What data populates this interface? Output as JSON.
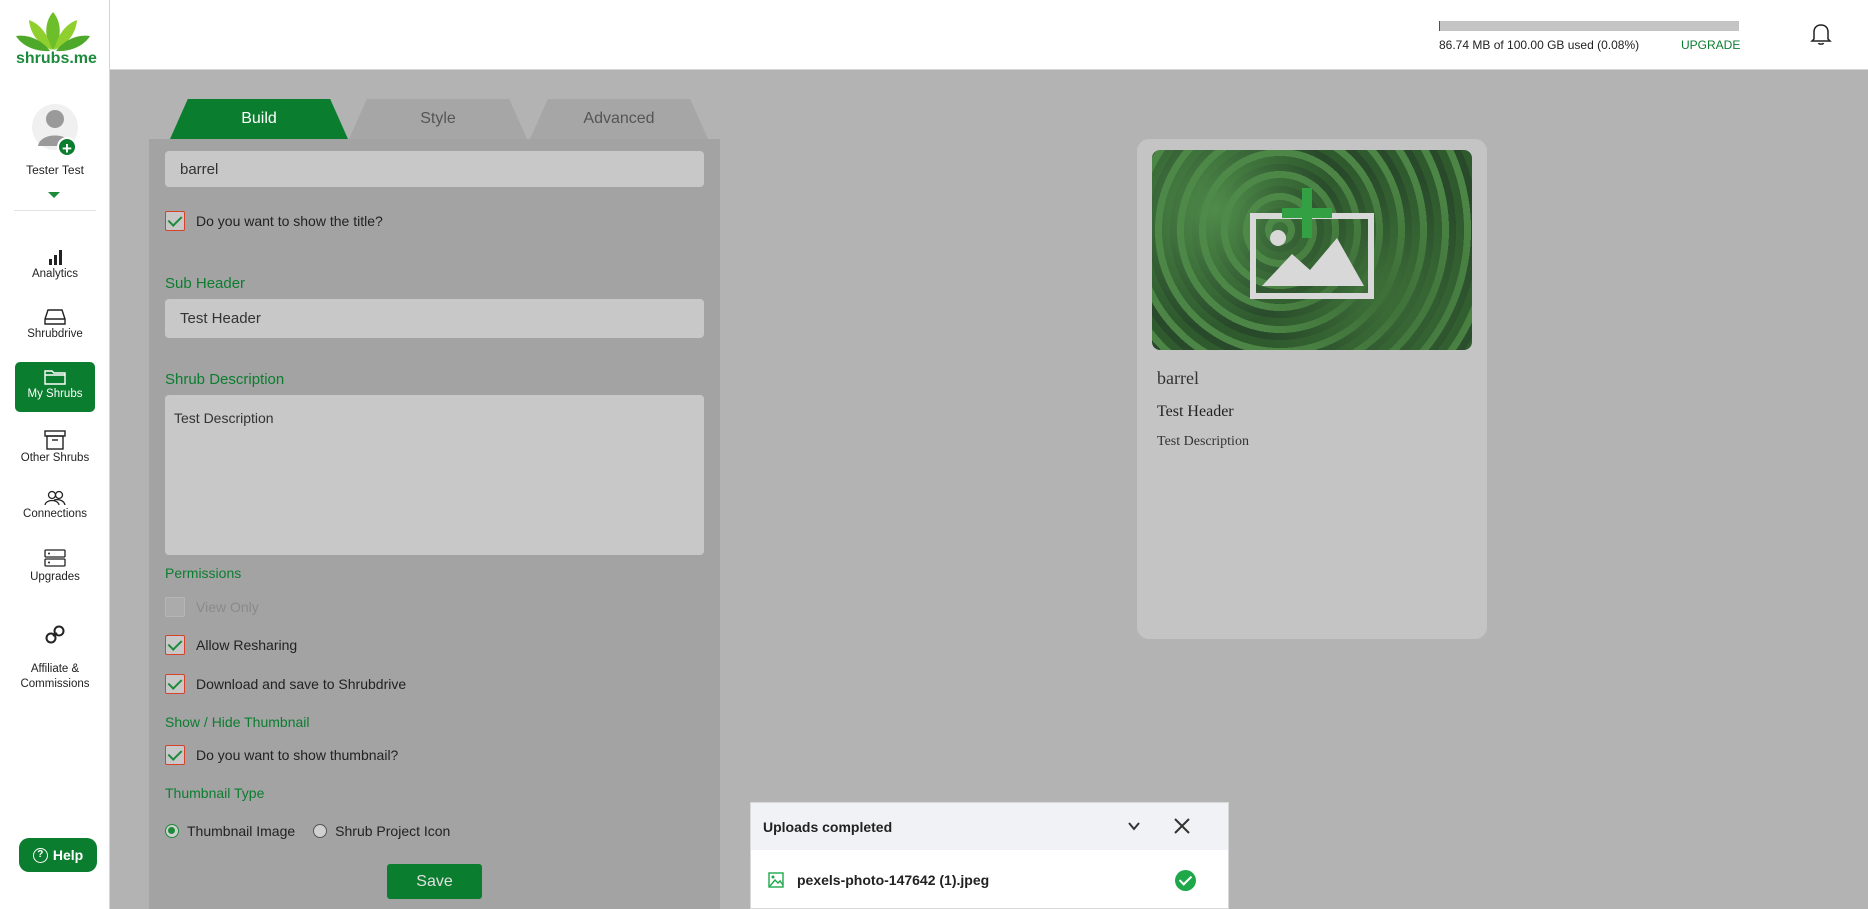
{
  "brand": {
    "name": "shrubs.me"
  },
  "user": {
    "name": "Tester Test"
  },
  "nav": [
    {
      "label": "Analytics",
      "icon": "bar-chart-icon"
    },
    {
      "label": "Shrubdrive",
      "icon": "drive-icon"
    },
    {
      "label": "My Shrubs",
      "icon": "folder-icon",
      "active": true
    },
    {
      "label": "Other Shrubs",
      "icon": "archive-icon"
    },
    {
      "label": "Connections",
      "icon": "users-icon"
    },
    {
      "label": "Upgrades",
      "icon": "server-icon"
    },
    {
      "label": "Affiliate &\nCommissions",
      "icon": "link-icon"
    }
  ],
  "help": {
    "label": "Help"
  },
  "header": {
    "storage_text": "86.74 MB of 100.00 GB used (0.08%)",
    "storage_used_fraction": 0.0008,
    "upgrade_label": "UPGRADE"
  },
  "tabs": {
    "build": "Build",
    "style": "Style",
    "advanced": "Advanced"
  },
  "form": {
    "title_value": "barrel",
    "show_title_label": "Do you want to show the title?",
    "sub_header_label": "Sub Header",
    "sub_header_value": "Test Header",
    "description_label": "Shrub Description",
    "description_value": "Test Description",
    "permissions_label": "Permissions",
    "view_only_label": "View Only",
    "allow_resharing_label": "Allow Resharing",
    "download_label": "Download and save to Shrubdrive",
    "thumbnail_section_label": "Show / Hide Thumbnail",
    "show_thumbnail_label": "Do you want to show thumbnail?",
    "thumbnail_type_label": "Thumbnail Type",
    "thumbnail_image_label": "Thumbnail Image",
    "project_icon_label": "Shrub Project Icon",
    "save_label": "Save"
  },
  "preview": {
    "title": "barrel",
    "sub_header": "Test Header",
    "description": "Test Description"
  },
  "uploads": {
    "heading": "Uploads completed",
    "file_name": "pexels-photo-147642 (1).jpeg"
  },
  "colors": {
    "brand_green": "#0b7d2f",
    "success": "#1ea84a",
    "checkbox_border": "#d9412c"
  }
}
